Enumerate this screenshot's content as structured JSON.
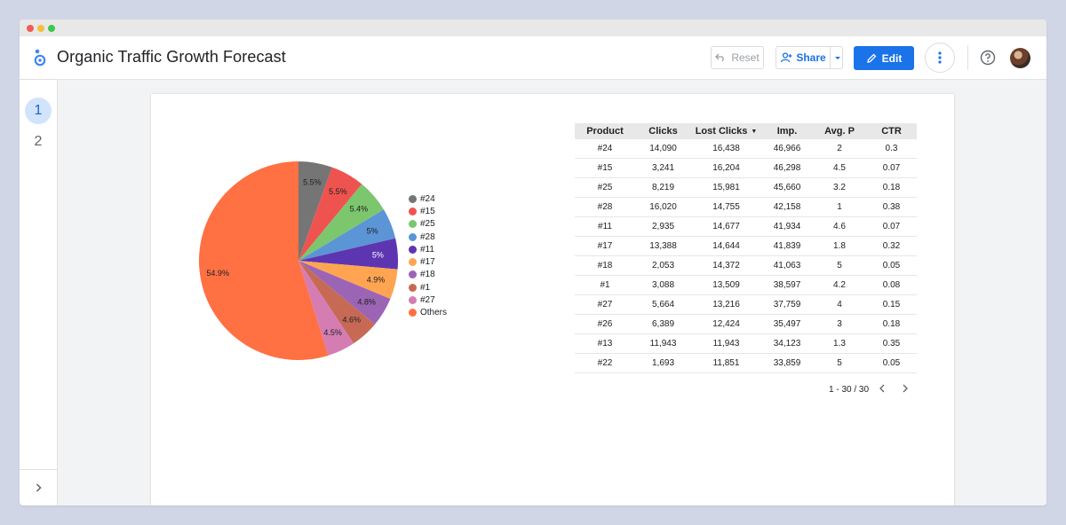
{
  "app": {
    "report_title": "Organic Traffic Growth Forecast",
    "reset_label": "Reset",
    "share_label": "Share",
    "edit_label": "Edit"
  },
  "colors": {
    "accent": "#1a73e8",
    "active_page_bg": "#d2e3fc"
  },
  "icons": [
    "looker-studio-logo-icon",
    "reset-icon",
    "add-person-icon",
    "chevron-down-icon",
    "pencil-icon",
    "more-vert-icon",
    "help-icon",
    "avatar",
    "chevron-right-icon",
    "chevron-left-icon"
  ],
  "sidebar": {
    "pages": [
      {
        "label": "1",
        "active": true
      },
      {
        "label": "2",
        "active": false
      }
    ]
  },
  "table": {
    "columns": [
      "Product",
      "Clicks",
      "Lost Clicks",
      "Imp.",
      "Avg. P",
      "CTR"
    ],
    "sorted_column": "Lost Clicks",
    "sort_direction": "descending",
    "rows": [
      [
        "#24",
        "14,090",
        "16,438",
        "46,966",
        "2",
        "0.3"
      ],
      [
        "#15",
        "3,241",
        "16,204",
        "46,298",
        "4.5",
        "0.07"
      ],
      [
        "#25",
        "8,219",
        "15,981",
        "45,660",
        "3.2",
        "0.18"
      ],
      [
        "#28",
        "16,020",
        "14,755",
        "42,158",
        "1",
        "0.38"
      ],
      [
        "#11",
        "2,935",
        "14,677",
        "41,934",
        "4.6",
        "0.07"
      ],
      [
        "#17",
        "13,388",
        "14,644",
        "41,839",
        "1.8",
        "0.32"
      ],
      [
        "#18",
        "2,053",
        "14,372",
        "41,063",
        "5",
        "0.05"
      ],
      [
        "#1",
        "3,088",
        "13,509",
        "38,597",
        "4.2",
        "0.08"
      ],
      [
        "#27",
        "5,664",
        "13,216",
        "37,759",
        "4",
        "0.15"
      ],
      [
        "#26",
        "6,389",
        "12,424",
        "35,497",
        "3",
        "0.18"
      ],
      [
        "#13",
        "11,943",
        "11,943",
        "34,123",
        "1.3",
        "0.35"
      ],
      [
        "#22",
        "1,693",
        "11,851",
        "33,859",
        "5",
        "0.05"
      ]
    ],
    "pagination": "1 - 30 / 30"
  },
  "chart_data": {
    "type": "pie",
    "legend_position": "right",
    "categories": [
      "#24",
      "#15",
      "#25",
      "#28",
      "#11",
      "#17",
      "#18",
      "#1",
      "#27",
      "Others"
    ],
    "values": [
      5.5,
      5.5,
      5.4,
      5.0,
      5.0,
      4.9,
      4.8,
      4.6,
      4.5,
      54.9
    ],
    "labels": [
      "5.5%",
      "5.5%",
      "5.4%",
      "5%",
      "5%",
      "4.9%",
      "4.8%",
      "4.6%",
      "4.5%",
      "54.9%"
    ],
    "colors": [
      "#757575",
      "#ef5350",
      "#7cc66e",
      "#5b95d6",
      "#5e35b1",
      "#ffa552",
      "#9c64b5",
      "#c76a55",
      "#d57db3",
      "#ff7043"
    ],
    "label_colors": [
      "#202124",
      "#202124",
      "#202124",
      "#202124",
      "#ffffff",
      "#202124",
      "#202124",
      "#202124",
      "#202124",
      "#202124"
    ]
  }
}
